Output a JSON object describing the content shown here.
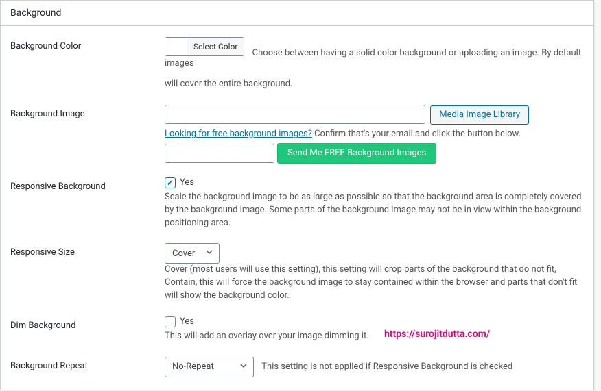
{
  "panel": {
    "title": "Background"
  },
  "fields": {
    "bgcolor": {
      "label": "Background Color",
      "button": "Select Color",
      "desc1": "Choose between having a solid color background or uploading an image. By default images",
      "desc2": "will cover the entire background."
    },
    "bgimage": {
      "label": "Background Image",
      "mediaBtn": "Media Image Library",
      "freeLink": "Looking for free background images?",
      "confirm": " Confirm that's your email and click the button below.",
      "sendBtn": "Send Me FREE Background Images"
    },
    "responsive": {
      "label": "Responsive Background",
      "yes": "Yes",
      "desc": "Scale the background image to be as large as possible so that the background area is completely covered by the background image. Some parts of the background image may not be in view within the background positioning area."
    },
    "size": {
      "label": "Responsive Size",
      "value": "Cover",
      "desc": "Cover (most users will use this setting), this setting will crop parts of the background that do not fit, Contain, this will force the background image to stay contained within the browser and parts that don't fit will show the background color."
    },
    "dim": {
      "label": "Dim Background",
      "yes": "Yes",
      "desc": "This will add an overlay over your image dimming it."
    },
    "repeat": {
      "label": "Background Repeat",
      "value": "No-Repeat",
      "desc": "This setting is not applied if Responsive Background is checked"
    }
  },
  "watermark": "https://surojitdutta.com/"
}
